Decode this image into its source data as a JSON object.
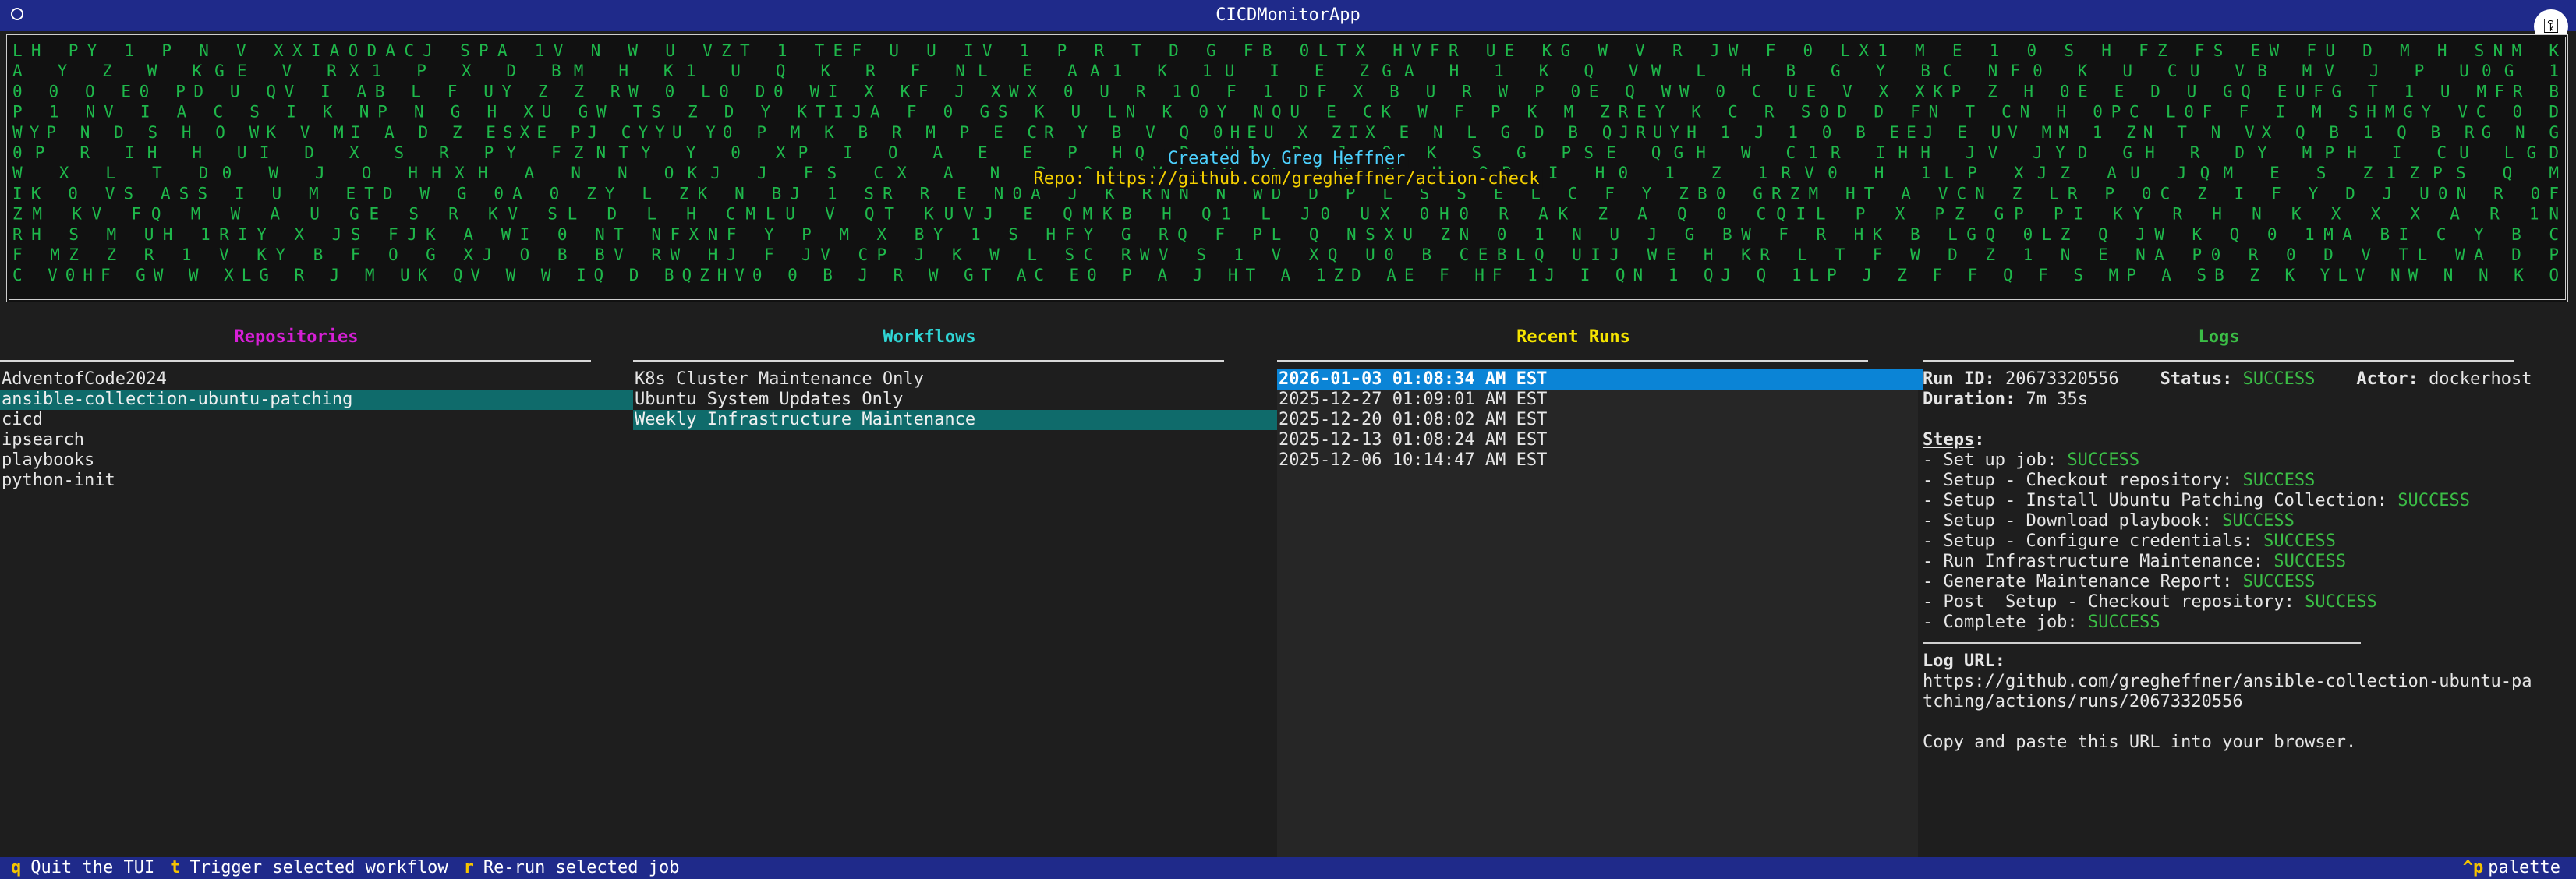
{
  "window": {
    "title": "CICDMonitorApp"
  },
  "banner": {
    "created_by": "Created by Greg Heffner",
    "repo": "Repo: https://github.com/gregheffner/action-check",
    "matrix_color": "#1fb84b",
    "credit_color": "#4dd2ff",
    "repo_color": "#f5d000",
    "matrix_rows": [
      "  LH   PY     1 P N V XXIAODACJ SPA     1V   N     W U VZT          1     TEF        U      U IV 1       P   R   T  D G FB  0LTX  HVFR  UE KG  W V           R    JW  F    0 LX1  M        E 1  0       S   H   FZ   FS   EW     FU D  M H SNM K",
      " A Y  Z      W    KGE       V RX1    P X D   BM  H   K1  U    Q    K R   F NL          E       AA1     K      1U I  E ZGA  H       1  K  Q   VW      L    H B   G Y         BC  NF0   K           U           CU       VB         MV J     P U0G     1",
      "  0   0  O   E0 PD U    QV         I  AB  L  F UY Z Z  RW  0 L0 D0          WI X     KF       J  XWX 0   U R 1O     F     1    DF    X B  U  R W P  0E        Q     WW 0      C    UE  V  X     XKP Z H    0E E  D   U  GQ  EUFG T      1  U  MFR B",
      "   P        1  NV I   A   C S I K NP  N     G  H        XU GW    TS    Z         D Y   KTIJA  F  0  GS  K U  LN K  0Y NQU    E  CK W F        P  K  M ZREY K     C       R S0D          D          FN      T CN     H 0PC      L0F  F  I  M    SHMGY VC        0  D",
      "WYP  N D  S  H    O      WK   V MI A D          Z  ESXE     PJ    CYYU  Y0  P  M  K B R M       P    E    CR    Y    B V Q    0HEU X    ZIX E  N  L G D B   QJRUYH 1 J        1        0     B  EEJ E  UV  MM 1  ZN T N       VX  Q B 1 Q   B    RG       N G",
      "      0P  R             IH     H  UI D      X      S R          PY FZNTY  Y  0     XP      I          O A E  E        P            HQ  D     H1    R J   Q K S      G  PSE QGH W  C1R    IHH   JV JYD    GH        R DY MPH     I         CU LGD",
      " W X  L   T   D0  W    J O     HHXH A N  N OKJ     J    FS        CX A       N    R       0A VT   V                                        I SB      Y     U QB  I   H0  1 Z 1RV0  H 1LP XJZ       AU   JQM          E    S  Z1ZPS   Q  M",
      "IK 0   VS ASS I  U  M   ETD W G 0A     0   ZY L      ZK  N                  BJ   1 SR R  E     N0A    J          K RNN  N WD D P  L  S         S E  L C        F      Y    ZB0    GRZM       HT  A      VCN    Z        LR  P 0C Z I  F Y D  J  U0N   R    0F",
      "      ZM    KV FQ  M   W    A   U GE    S     R   KV              SL D    L H      CMLU     V  QT     KUVJ          E  QMKB          H     Q1     L  J0    UX 0H0  R AK      Z A  Q    0   CQIL       P X PZ  GP          PI  KY     R H    N   K  X  X X A   R  1N",
      "RH S M         UH 1RIY    X JS     FJK A  WI    0         NT NFXNF Y  P M   X BY      1       S                   HFY  G RQ       F     PL Q  NSXU  ZN 0  1      N  U J      G BW     F     R HK  B LGQ 0LZ Q       JW K Q              0   1MA   BI  C Y B C",
      "F MZ   Z   R    1 V KY    B F O    G   XJ    O    B      BV       RW HJ    F JV       CP      J    K  W          L SC  RWV  S             1 V     XQ U0   B CEBLQ UIJ  WE       H          KR L  T F W    D Z  1     N   E  NA   P0      R 0 D V     TL   WA  D P",
      "C   V0HF    GW W    XLG         R J  M    UK      QV W  W   IQ    D      BQZHV0  0  B J  R         W GT AC        E0  P  A              J  HT  A     1ZD AE F HF 1J  I QN  1   QJ Q 1LP J Z F F Q     F   S  MP A SB  Z          K YLV          NW  N  N   K  O"
    ]
  },
  "panels": {
    "repositories": {
      "title": "Repositories",
      "color": "#d61fd6",
      "items": [
        "AdventofCode2024",
        "ansible-collection-ubuntu-patching",
        "cicd",
        "ipsearch",
        "playbooks",
        "python-init"
      ]
    },
    "workflows": {
      "title": "Workflows",
      "color": "#2fd4d4",
      "items": [
        "K8s Cluster Maintenance Only",
        "Ubuntu System Updates Only",
        "Weekly Infrastructure Maintenance"
      ]
    },
    "runs": {
      "title": "Recent Runs",
      "color": "#f5e400",
      "items": [
        "2026-01-03 01:08:34 AM EST",
        "2025-12-27 01:09:01 AM EST",
        "2025-12-20 01:08:02 AM EST",
        "2025-12-13 01:08:24 AM EST",
        "2025-12-06 10:14:47 AM EST"
      ]
    },
    "logs": {
      "title": "Logs",
      "color": "#3bbd46",
      "run_id_label": "Run ID:",
      "run_id": "20673320556",
      "status_label": "Status:",
      "status": "SUCCESS",
      "actor_label": "Actor:",
      "actor": "dockerhost",
      "duration_label": "Duration:",
      "duration": "7m 35s",
      "steps_label": "Steps",
      "steps_colon": ":",
      "steps": [
        {
          "name": "- Set up job: ",
          "status": "SUCCESS"
        },
        {
          "name": "- Setup - Checkout repository: ",
          "status": "SUCCESS"
        },
        {
          "name": "- Setup - Install Ubuntu Patching Collection: ",
          "status": "SUCCESS"
        },
        {
          "name": "- Setup - Download playbook: ",
          "status": "SUCCESS"
        },
        {
          "name": "- Setup - Configure credentials: ",
          "status": "SUCCESS"
        },
        {
          "name": "- Run Infrastructure Maintenance: ",
          "status": "SUCCESS"
        },
        {
          "name": "- Generate Maintenance Report: ",
          "status": "SUCCESS"
        },
        {
          "name": "- Post  Setup - Checkout repository: ",
          "status": "SUCCESS"
        },
        {
          "name": "- Complete job: ",
          "status": "SUCCESS"
        }
      ],
      "log_url_label": "Log URL:",
      "log_url_line1": "https://github.com/gregheffner/ansible-collection-ubuntu-pa",
      "log_url_line2": "tching/actions/runs/20673320556",
      "copy_hint": "Copy and paste this URL into your browser."
    }
  },
  "footer": {
    "quit_key": "q",
    "quit_label": "Quit the TUI",
    "trigger_key": "t",
    "trigger_label": "Trigger selected workflow",
    "rerun_key": "r",
    "rerun_label": "Re-run selected job",
    "palette_key": "^p",
    "palette_label": "palette"
  }
}
